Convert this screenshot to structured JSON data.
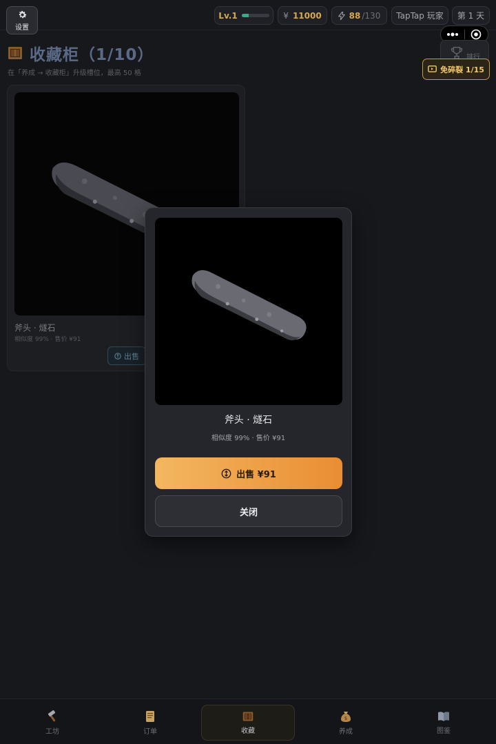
{
  "topbar": {
    "settings_label": "设置",
    "level": {
      "label": "Lv.1",
      "progress": 0.25
    },
    "coins": {
      "symbol": "¥",
      "value": "11000"
    },
    "energy": {
      "current": "88",
      "max": "/130"
    },
    "player_name": "TapTap 玩家",
    "day_label": "第 1 天"
  },
  "page": {
    "title": "收藏柜（1/10）",
    "subtitle": "在「养成 → 收藏柜」升级槽位，最高 50 格",
    "rank_label": "排行",
    "free_label": "免碎裂 1/15"
  },
  "card": {
    "name": "斧头 · 燧石",
    "meta": "相似度 99% · 售价 ¥91",
    "sell_label": "出售"
  },
  "modal": {
    "name": "斧头 · 燧石",
    "meta": "相似度 99% · 售价 ¥91",
    "sell_label": "出售 ¥91",
    "close_label": "关闭"
  },
  "nav": {
    "items": [
      {
        "label": "工坊",
        "icon": "hammer-icon"
      },
      {
        "label": "订单",
        "icon": "scroll-icon"
      },
      {
        "label": "收藏",
        "icon": "cabinet-icon"
      },
      {
        "label": "养成",
        "icon": "moneybag-icon"
      },
      {
        "label": "图鉴",
        "icon": "book-icon"
      }
    ],
    "active_index": 2
  },
  "colors": {
    "accent_gold": "#d6a94a",
    "sell_gradient_start": "#f3b760",
    "sell_gradient_end": "#ea8d33",
    "title_blue": "#5a6a86"
  }
}
